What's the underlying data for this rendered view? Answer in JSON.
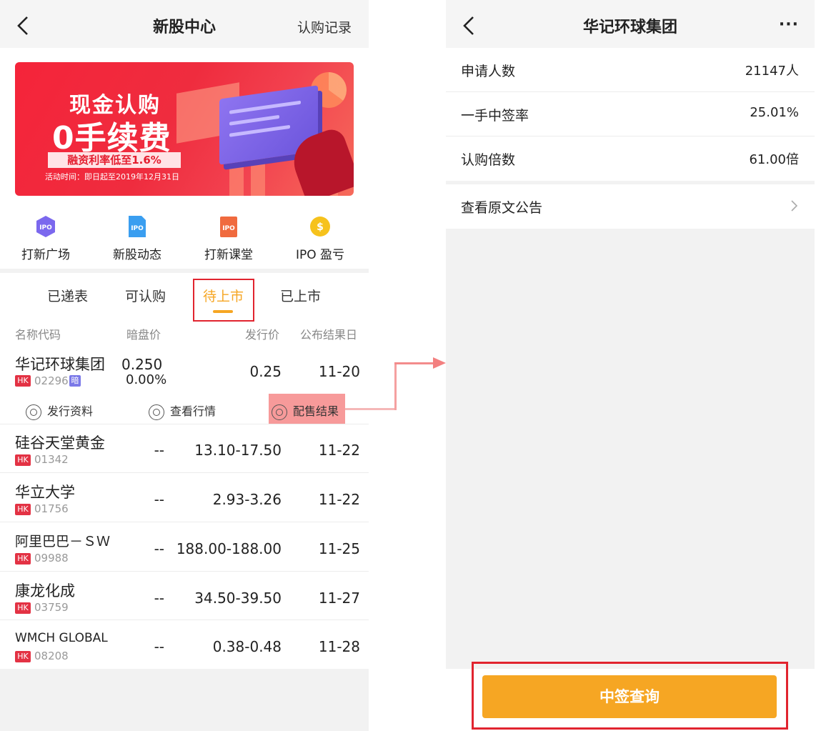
{
  "left": {
    "nav": {
      "title": "新股中心",
      "right_link": "认购记录"
    },
    "banner": {
      "headline": "现金认购",
      "subheadline": "0手续费",
      "tag": "融资利率低至1.6%",
      "period": "活动时间：即日起至2019年12月31日"
    },
    "quick_links": [
      {
        "label": "打新广场",
        "icon": "ipo-hexagon-icon",
        "icon_text": "IPO",
        "color": "#7b68ee"
      },
      {
        "label": "新股动态",
        "icon": "ipo-document-icon",
        "icon_text": "IPO",
        "color": "#3a9ef0"
      },
      {
        "label": "打新课堂",
        "icon": "ipo-book-icon",
        "icon_text": "IPO",
        "color": "#f06a3e"
      },
      {
        "label": "IPO 盈亏",
        "icon": "dollar-coin-icon",
        "icon_text": "$",
        "color": "#f6c21c"
      }
    ],
    "tabs": [
      "已递表",
      "可认购",
      "待上市",
      "已上市"
    ],
    "active_tab": "待上市",
    "columns": [
      "名称代码",
      "暗盘价",
      "发行价",
      "公布结果日"
    ],
    "rows": [
      {
        "name": "华记环球集团",
        "market": "HK",
        "code": "02296",
        "dark_badge": "暗",
        "dark_price": "0.250",
        "dark_change": "0.00%",
        "issue_price": "0.25",
        "result_date": "11-20"
      },
      {
        "name": "硅谷天堂黄金",
        "market": "HK",
        "code": "01342",
        "dark_price": "--",
        "issue_price": "13.10-17.50",
        "result_date": "11-22"
      },
      {
        "name": "华立大学",
        "market": "HK",
        "code": "01756",
        "dark_price": "--",
        "issue_price": "2.93-3.26",
        "result_date": "11-22"
      },
      {
        "name": "阿里巴巴－ＳＷ",
        "market": "HK",
        "code": "09988",
        "dark_price": "--",
        "issue_price": "188.00-188.00",
        "result_date": "11-25"
      },
      {
        "name": "康龙化成",
        "market": "HK",
        "code": "03759",
        "dark_price": "--",
        "issue_price": "34.50-39.50",
        "result_date": "11-27"
      },
      {
        "name": "WMCH GLOBAL",
        "market": "HK",
        "code": "08208",
        "dark_price": "--",
        "issue_price": "0.38-0.48",
        "result_date": "11-28"
      }
    ],
    "row_actions": [
      "发行资料",
      "查看行情",
      "配售结果"
    ]
  },
  "right": {
    "nav": {
      "title": "华记环球集团"
    },
    "stats": [
      {
        "label": "申请人数",
        "value": "21147人"
      },
      {
        "label": "一手中签率",
        "value": "25.01%"
      },
      {
        "label": "认购倍数",
        "value": "61.00倍"
      }
    ],
    "announcement_link": "查看原文公告",
    "primary_button": "中签查询"
  },
  "colors": {
    "accent": "#f6a623",
    "highlight_red": "#e1242f",
    "hk_badge": "#e33244",
    "dark_badge": "#7b79e8"
  }
}
